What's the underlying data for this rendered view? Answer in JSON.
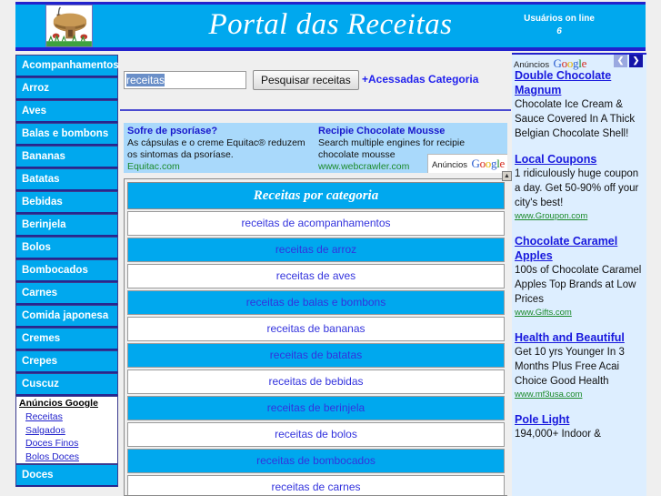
{
  "header": {
    "title": "Portal das Receitas",
    "users_label": "Usuários on line",
    "users_count": "6",
    "logo_alt": "mushroom-house-logo"
  },
  "sidebar": {
    "categories": [
      "Acompanhamentos",
      "Arroz",
      "Aves",
      "Balas e bombons",
      "Bananas",
      "Batatas",
      "Bebidas",
      "Berinjela",
      "Bolos",
      "Bombocados",
      "Carnes",
      "Comida japonesa",
      "Cremes",
      "Crepes",
      "Cuscuz"
    ],
    "ads": {
      "heading": "Anúncios Google",
      "links": [
        "Receitas",
        "Salgados",
        "Doces Finos",
        "Bolos Doces"
      ]
    },
    "categories_after_ads": [
      "Doces"
    ]
  },
  "search": {
    "value": "receitas",
    "placeholder": "",
    "button_label": "Pesquisar receitas",
    "quick_links": "+Acessadas Categoria"
  },
  "banner_ads": {
    "google_label": "Anúncios",
    "google_logo": "Google",
    "items": [
      {
        "title": "Sofre de psoríase?",
        "desc": "As cápsulas e o creme Equitac® reduzem os sintomas da psoríase.",
        "url": "Equitac.com"
      },
      {
        "title": "Recipie Chocolate Mousse",
        "desc": "Search multiple engines for recipie chocolate mousse",
        "url": "www.webcrawler.com"
      }
    ]
  },
  "category_panel": {
    "heading": "Receitas por categoria",
    "rows": [
      "receitas de acompanhamentos",
      "receitas de arroz",
      "receitas de aves",
      "receitas de balas e bombons",
      "receitas de bananas",
      "receitas de batatas",
      "receitas de bebidas",
      "receitas de berinjela",
      "receitas de bolos",
      "receitas de bombocados",
      "receitas de carnes"
    ],
    "scroll_arrow": "▲"
  },
  "right_ads": {
    "google_label": "Anúncios",
    "google_logo": "Google",
    "prev_arrow": "❮",
    "next_arrow": "❯",
    "items": [
      {
        "title": "Double Chocolate Magnum",
        "desc": "Chocolate Ice Cream & Sauce Covered In A Thick Belgian Chocolate Shell!",
        "url": ""
      },
      {
        "title": "Local Coupons",
        "desc": "1 ridiculously huge coupon a day. Get 50-90% off your city's best!",
        "url": "www.Groupon.com"
      },
      {
        "title": "Chocolate Caramel Apples",
        "desc": "100s of Chocolate Caramel Apples Top Brands at Low Prices",
        "url": "www.Gifts.com"
      },
      {
        "title": "Health and Beautiful",
        "desc": "Get 10 yrs Younger In 3 Months Plus Free Acai Choice Good Health",
        "url": "www.mf3usa.com"
      },
      {
        "title": "Pole Light",
        "desc": "194,000+ Indoor &",
        "url": ""
      }
    ]
  },
  "colors": {
    "brand_blue": "#00A8EE",
    "border_blue": "#2222CC",
    "link_blue": "#3333DD",
    "ad_bg": "#DDEEFF",
    "banner_ad_bg": "#A9D9FB"
  }
}
